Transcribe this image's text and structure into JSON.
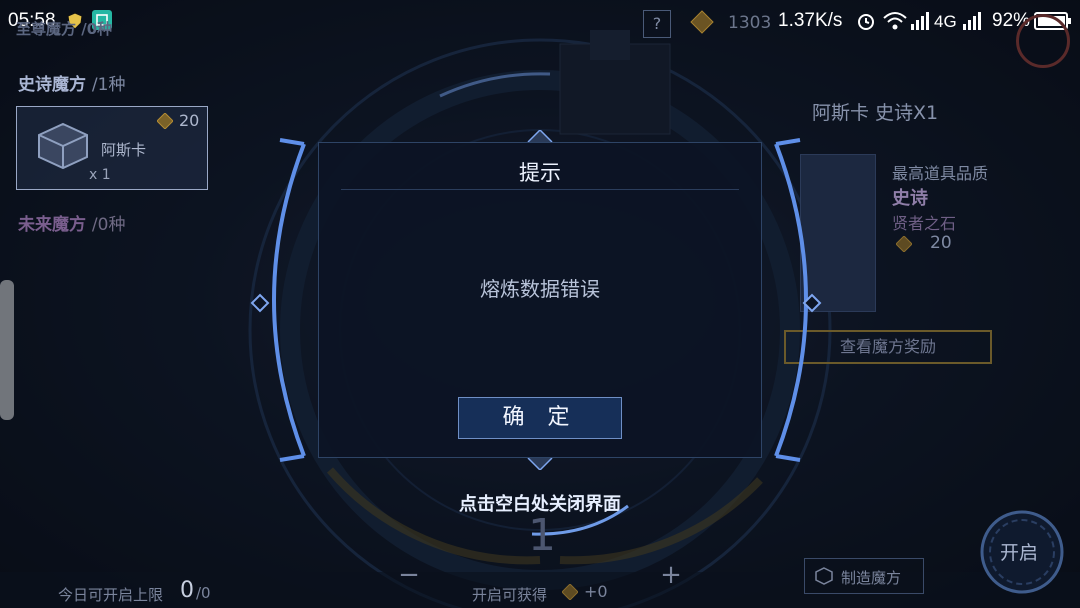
{
  "status_bar": {
    "time": "05:58",
    "network_speed": "1.37K/s",
    "network_type": "4G",
    "battery": "92%",
    "icons": [
      "shield-icon",
      "scan-icon",
      "alarm-icon",
      "wifi-icon",
      "signal-icon",
      "battery-icon"
    ]
  },
  "top_bar": {
    "help_label": "?",
    "currency_value": "1303"
  },
  "left_panel": {
    "top_cut_label": "至尊魔方 /0种",
    "epic_section_title": "史诗魔方",
    "epic_section_count": "/1种",
    "card": {
      "name": "阿斯卡",
      "cost": "20",
      "quantity": "x 1"
    },
    "future_section_title": "未来魔方",
    "future_section_count": "/0种"
  },
  "right_panel": {
    "title": "阿斯卡 史诗X1",
    "quality_label": "最高道具品质",
    "quality_value": "史诗",
    "item_name": "贤者之石",
    "item_cost": "20",
    "reward_button": "查看魔方奖励"
  },
  "bottom_bar": {
    "daily_limit_label": "今日可开启上限",
    "daily_limit_value": "0",
    "daily_limit_max": "/0",
    "minus_label": "−",
    "plus_label": "+",
    "count_value": "1",
    "obtain_label": "开启可获得",
    "obtain_value": "+0",
    "craft_button": "制造魔方",
    "open_button": "开启"
  },
  "dialog": {
    "title": "提示",
    "message": "熔炼数据错误",
    "confirm_label": "确 定",
    "close_hint": "点击空白处关闭界面"
  },
  "colors": {
    "accent_blue": "#5f8fe8",
    "dialog_bg": "#0c1424",
    "gold": "#c79a3a"
  }
}
